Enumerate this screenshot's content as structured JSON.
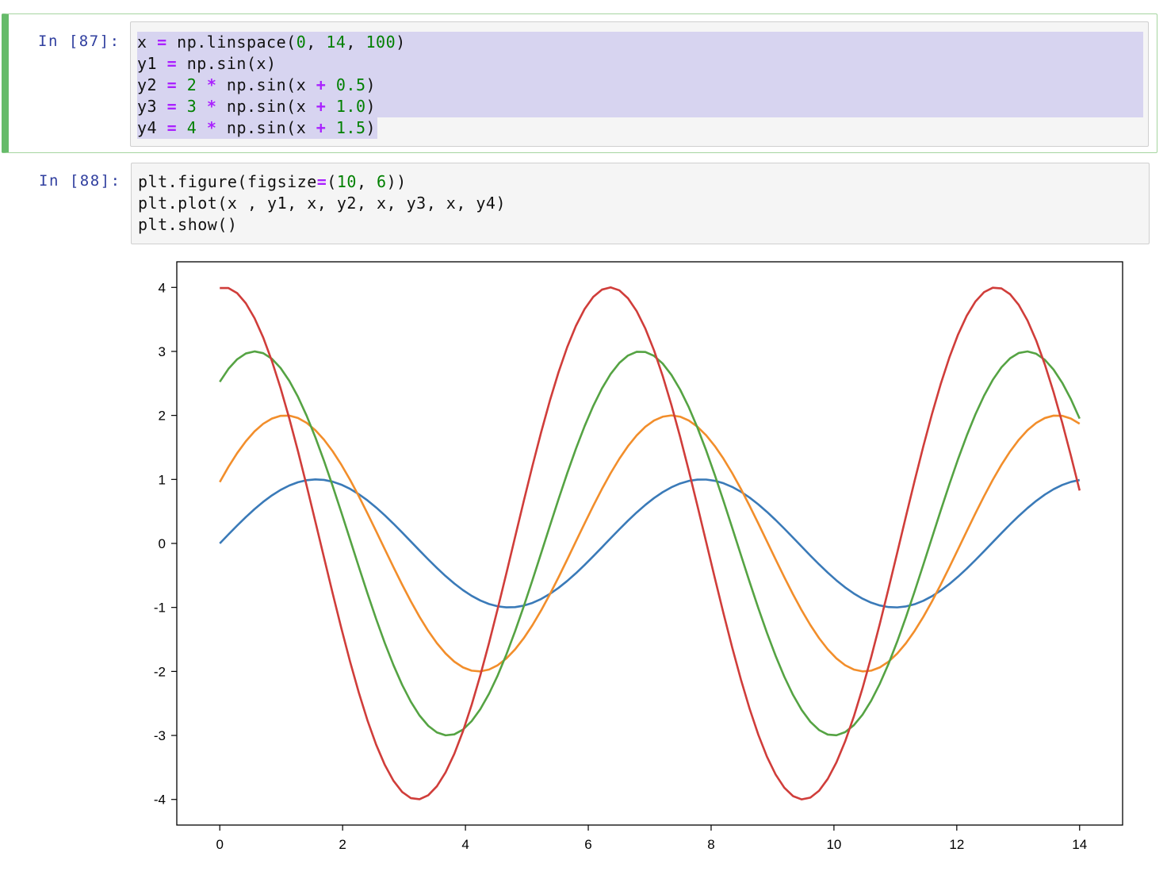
{
  "cells": [
    {
      "prompt": "In [87]:",
      "lines": [
        [
          [
            "x ",
            "n"
          ],
          [
            "=",
            "op"
          ],
          [
            " np.linspace(",
            "n"
          ],
          [
            "0",
            "num"
          ],
          [
            ", ",
            "n"
          ],
          [
            "14",
            "num"
          ],
          [
            ", ",
            "n"
          ],
          [
            "100",
            "num"
          ],
          [
            ")",
            "n"
          ]
        ],
        [
          [
            "y1 ",
            "n"
          ],
          [
            "=",
            "op"
          ],
          [
            " np.sin(x)",
            "n"
          ]
        ],
        [
          [
            "y2 ",
            "n"
          ],
          [
            "=",
            "op"
          ],
          [
            " ",
            "n"
          ],
          [
            "2",
            "num"
          ],
          [
            " ",
            "n"
          ],
          [
            "*",
            "op"
          ],
          [
            " np.sin(x ",
            "n"
          ],
          [
            "+",
            "op"
          ],
          [
            " ",
            "n"
          ],
          [
            "0.5",
            "num"
          ],
          [
            ")",
            "n"
          ]
        ],
        [
          [
            "y3 ",
            "n"
          ],
          [
            "=",
            "op"
          ],
          [
            " ",
            "n"
          ],
          [
            "3",
            "num"
          ],
          [
            " ",
            "n"
          ],
          [
            "*",
            "op"
          ],
          [
            " np.sin(x ",
            "n"
          ],
          [
            "+",
            "op"
          ],
          [
            " ",
            "n"
          ],
          [
            "1.0",
            "num"
          ],
          [
            ")",
            "n"
          ]
        ],
        [
          [
            "y4 ",
            "n"
          ],
          [
            "=",
            "op"
          ],
          [
            " ",
            "n"
          ],
          [
            "4",
            "num"
          ],
          [
            " ",
            "n"
          ],
          [
            "*",
            "op"
          ],
          [
            " np.sin(x ",
            "n"
          ],
          [
            "+",
            "op"
          ],
          [
            " ",
            "n"
          ],
          [
            "1.5",
            "num"
          ],
          [
            ")",
            "n"
          ]
        ]
      ]
    },
    {
      "prompt": "In [88]:",
      "lines": [
        [
          [
            "plt.figure(figsize",
            "n"
          ],
          [
            "=",
            "op"
          ],
          [
            "(",
            "n"
          ],
          [
            "10",
            "num"
          ],
          [
            ", ",
            "n"
          ],
          [
            "6",
            "num"
          ],
          [
            "))",
            "n"
          ]
        ],
        [
          [
            "plt.plot(x , y1, x, y2, x, y3, x, y4)",
            "n"
          ]
        ],
        [
          [
            "plt.show()",
            "n"
          ]
        ]
      ]
    }
  ],
  "colors": {
    "code_text": "#111111",
    "operator": "#aa22ff",
    "number": "#008000",
    "prompt": "#303f9f",
    "selection": "#d7d4f0",
    "selected_cell_bar": "#66bb6a"
  },
  "chart_data": {
    "type": "line",
    "x_function": "linspace(0, 14, 100)",
    "series": [
      {
        "amplitude": 1,
        "phase": 0.0,
        "color": "#3a7ab8"
      },
      {
        "amplitude": 2,
        "phase": 0.5,
        "color": "#f28e2b"
      },
      {
        "amplitude": 3,
        "phase": 1.0,
        "color": "#55a343"
      },
      {
        "amplitude": 4,
        "phase": 1.5,
        "color": "#d03d3a"
      }
    ],
    "xlim": [
      -0.7,
      14.7
    ],
    "ylim": [
      -4.4,
      4.4
    ],
    "x_ticks": [
      "0",
      "2",
      "4",
      "6",
      "8",
      "10",
      "12",
      "14"
    ],
    "x_tick_values": [
      0,
      2,
      4,
      6,
      8,
      10,
      12,
      14
    ],
    "y_ticks": [
      "4",
      "3",
      "2",
      "1",
      "0",
      "-1",
      "-2",
      "-3",
      "-4"
    ],
    "y_tick_values": [
      4,
      3,
      2,
      1,
      0,
      -1,
      -2,
      -3,
      -4
    ],
    "grid": false,
    "legend": false
  }
}
